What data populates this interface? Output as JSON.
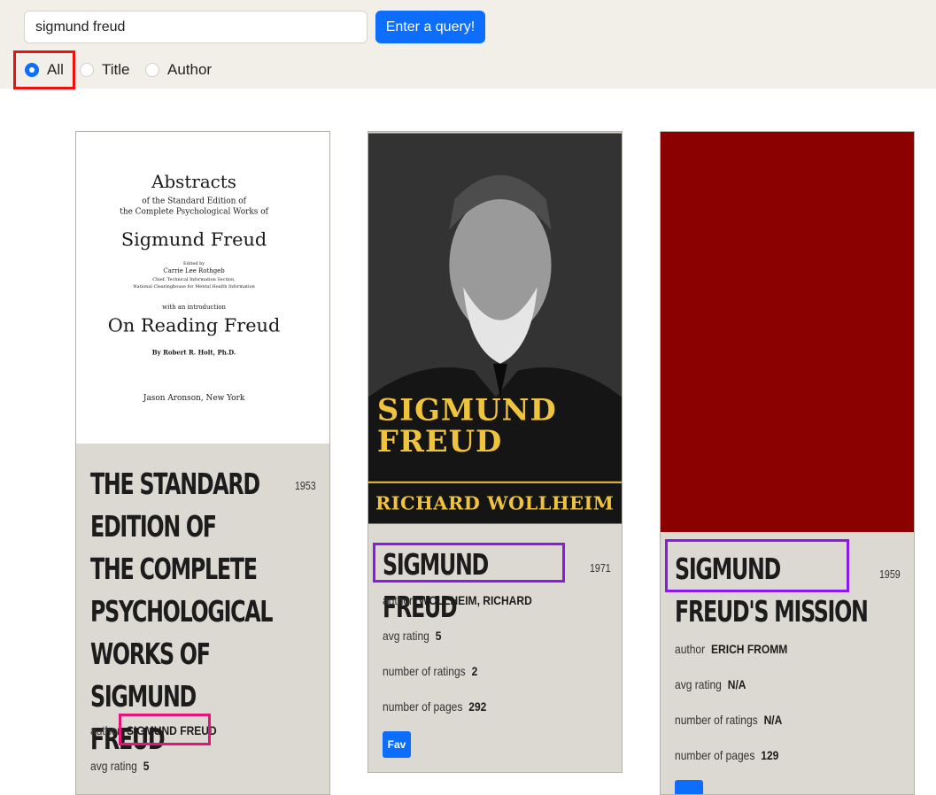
{
  "search": {
    "value": "sigmund freud",
    "button_label": "Enter a query!"
  },
  "filters": {
    "options": [
      "All",
      "Title",
      "Author"
    ],
    "selected": "All"
  },
  "cards": [
    {
      "cover_text": [
        "Abstracts",
        "of the Standard Edition of",
        "the Complete Psychological Works of",
        "Sigmund Freud",
        "Edited by",
        "Carrie Lee Rothgeb",
        "Chief, Technical Information Section,",
        "National Clearinghouse for Mental Health Information",
        "with an introduction",
        "On Reading Freud",
        "By Robert R. Holt, Ph.D.",
        "Jason Aronson, New York"
      ],
      "title": "The Standard Edition of the Complete Psychological Works of Sigmund Freud",
      "year": "1953",
      "author_label": "author",
      "author": "SIGMUND FREUD",
      "rating_label": "avg rating",
      "rating": "5"
    },
    {
      "cover_text": [
        "SIGMUND",
        "FREUD",
        "RICHARD WOLLHEIM"
      ],
      "title": "Sigmund Freud",
      "year": "1971",
      "author_label": "author",
      "author": "WOLLHEIM, RICHARD",
      "rating_label": "avg rating",
      "rating": "5",
      "ratings_count_label": "number of ratings",
      "ratings_count": "2",
      "pages_label": "number of pages",
      "pages": "292",
      "fav_label": "Fav"
    },
    {
      "title": "Sigmund Freud's Mission",
      "year": "1959",
      "author_label": "author",
      "author": "ERICH FROMM",
      "rating_label": "avg rating",
      "rating": "N/A",
      "ratings_count_label": "number of ratings",
      "ratings_count": "N/A",
      "pages_label": "number of pages",
      "pages": "129"
    }
  ],
  "colors": {
    "accent": "#0d6efd",
    "card_bg": "#dcd9d2",
    "topbar_bg": "#f2efe9",
    "highlight_red": "#ee1111",
    "highlight_pink": "#e6147a",
    "highlight_purple": "#8a19ee",
    "cover_red": "#8b0000"
  }
}
